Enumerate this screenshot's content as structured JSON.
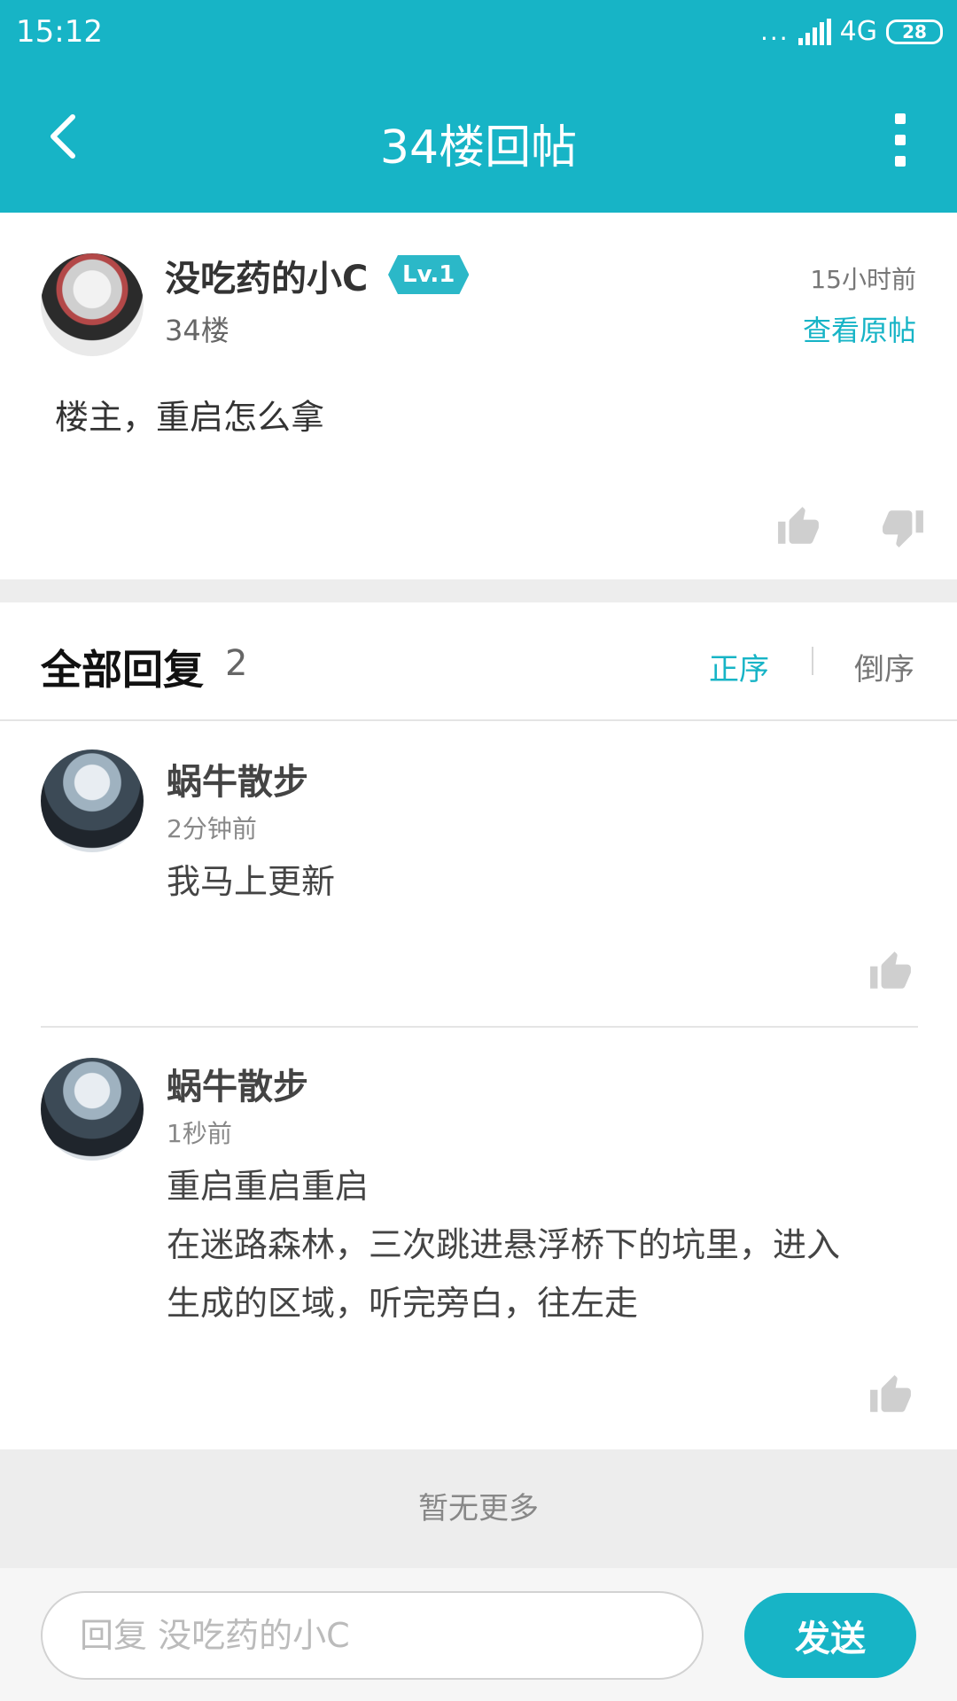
{
  "status_bar": {
    "time": "15:12",
    "dots": "...",
    "network": "4G",
    "battery": "28"
  },
  "nav": {
    "title": "34楼回帖"
  },
  "post": {
    "author": "没吃药的小C",
    "level": "Lv.1",
    "floor": "34楼",
    "time": "15小时前",
    "view_original": "查看原帖",
    "content": "楼主，重启怎么拿"
  },
  "replies_header": {
    "title": "全部回复",
    "count": "2",
    "sort_asc": "正序",
    "sort_desc": "倒序"
  },
  "replies": [
    {
      "name": "蜗牛散步",
      "time": "2分钟前",
      "lines": [
        "我马上更新"
      ]
    },
    {
      "name": "蜗牛散步",
      "time": "1秒前",
      "lines": [
        "重启重启重启",
        "在迷路森林，三次跳进悬浮桥下的坑里，进入",
        "生成的区域，听完旁白，往左走"
      ]
    }
  ],
  "footer": {
    "no_more": "暂无更多"
  },
  "input": {
    "placeholder": "回复 没吃药的小C",
    "send_label": "发送"
  },
  "colors": {
    "accent": "#17b4c6",
    "separator": "#ededed"
  },
  "icons": [
    "back-arrow-icon",
    "more-vertical-icon",
    "thumbs-up-icon",
    "thumbs-down-icon"
  ]
}
